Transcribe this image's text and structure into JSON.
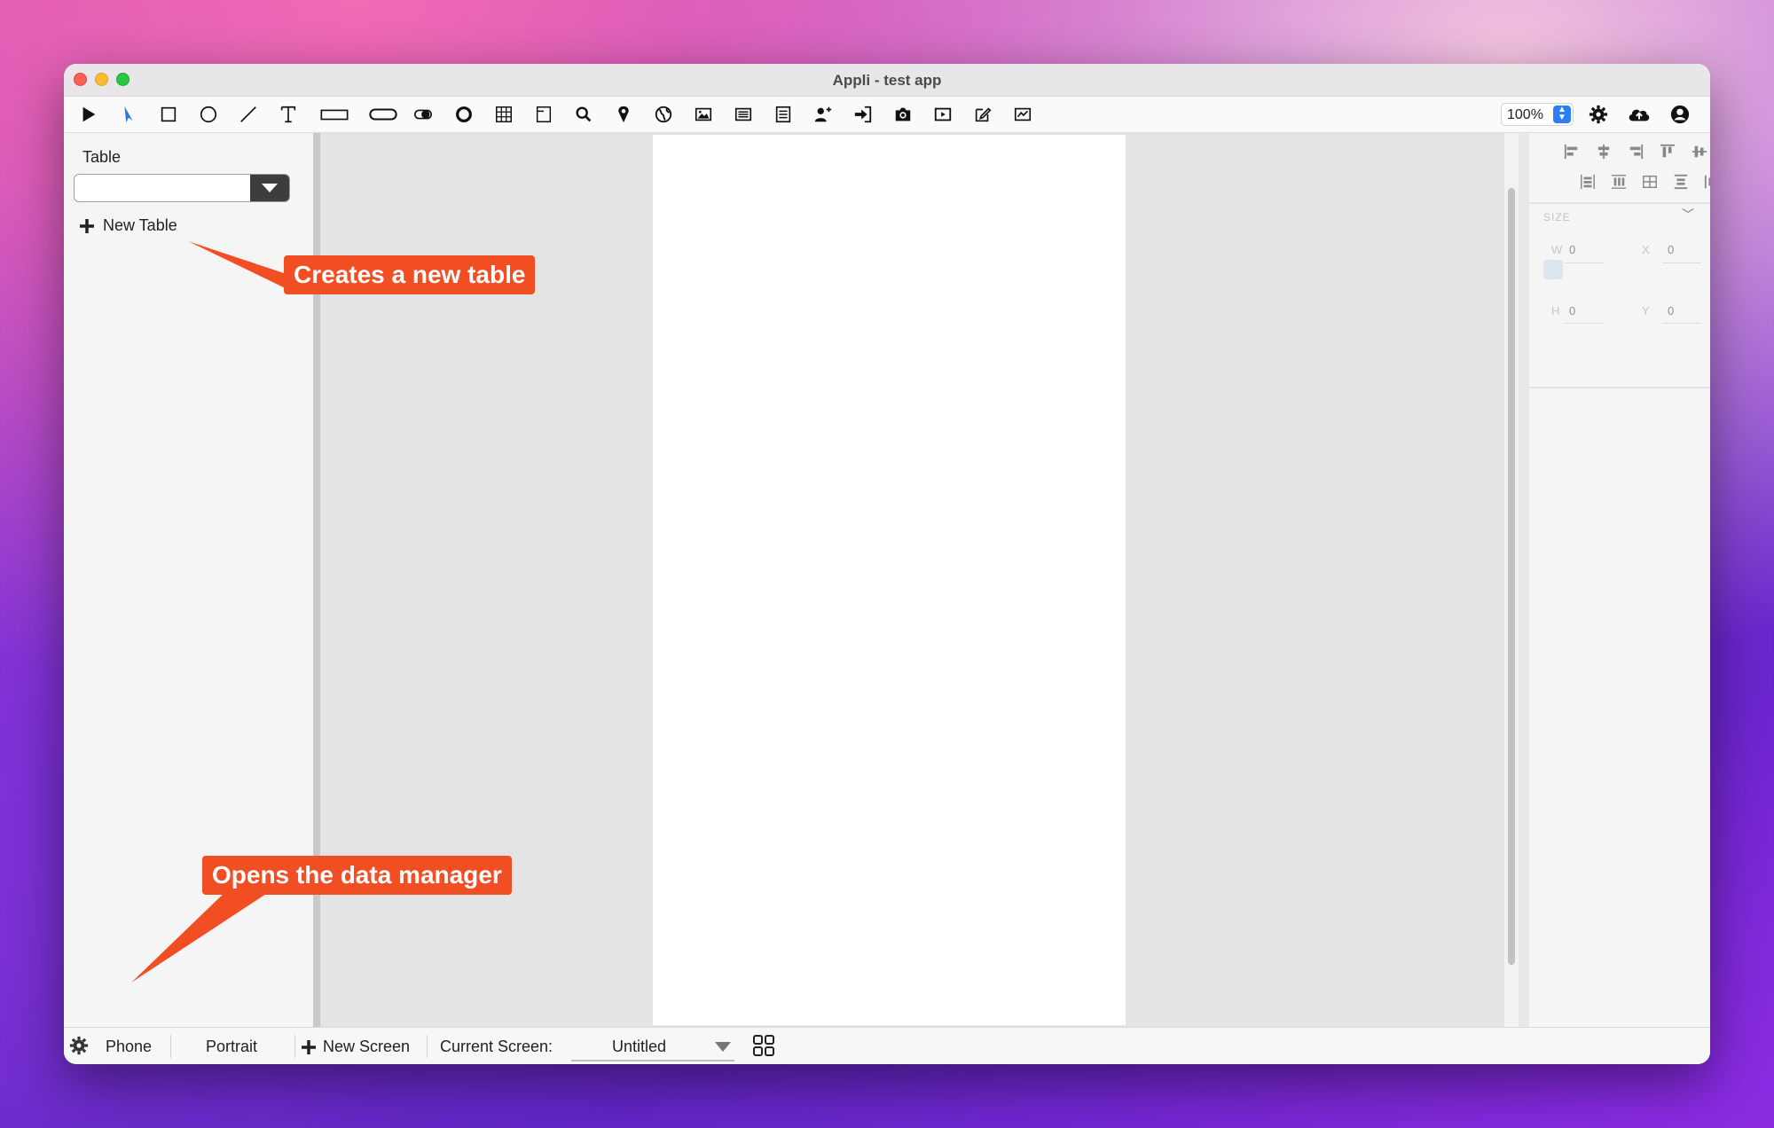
{
  "window": {
    "title": "Appli - test app"
  },
  "toolbar": {
    "tools": [
      "play-icon",
      "pointer-icon",
      "rectangle-icon",
      "ellipse-icon",
      "line-icon",
      "text-icon",
      "text-field-icon",
      "button-icon",
      "toggle-icon",
      "radio-icon",
      "grid-icon",
      "page-icon",
      "search-icon",
      "map-pin-icon",
      "globe-icon",
      "image-icon",
      "list-icon",
      "form-icon",
      "add-user-icon",
      "login-icon",
      "camera-icon",
      "video-icon",
      "edit-icon",
      "chart-icon"
    ],
    "zoom": "100%",
    "right_icons": [
      "settings-icon",
      "cloud-upload-icon",
      "account-icon"
    ]
  },
  "left_panel": {
    "table_label": "Table",
    "table_select_value": "",
    "new_table_label": "New Table",
    "bottom_icons": [
      "list-view-icon",
      "database-icon",
      "bookmark-icon"
    ],
    "accent": "#2d9cdb"
  },
  "right_panel": {
    "section_title": "SIZE",
    "fields": [
      {
        "label": "W",
        "value": "0"
      },
      {
        "label": "X",
        "value": "0"
      },
      {
        "label": "H",
        "value": "0"
      },
      {
        "label": "Y",
        "value": "0"
      }
    ]
  },
  "bottom_bar": {
    "device": "Phone",
    "orientation": "Portrait",
    "new_screen_label": "New Screen",
    "current_screen_label": "Current Screen:",
    "current_screen_value": "Untitled"
  },
  "callouts": {
    "new_table": "Creates a new table",
    "data_manager": "Opens the data manager",
    "color": "#f24e24"
  }
}
